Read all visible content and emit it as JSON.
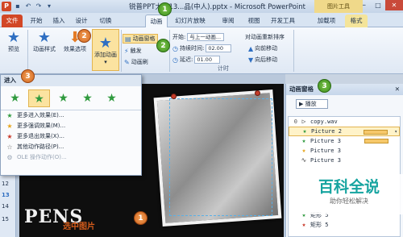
{
  "window": {
    "app_logo": "P",
    "title": "锐普PPT大赛13...品(中人).pptx - Microsoft PowerPoint",
    "controls": [
      "─",
      "□",
      "✕"
    ],
    "qat_icons": [
      "save-icon",
      "undo-icon",
      "redo-icon",
      "customize-icon"
    ]
  },
  "ribbon_tabs": {
    "file": "文件",
    "tabs": [
      "开始",
      "插入",
      "设计",
      "切换",
      "动画",
      "幻灯片放映",
      "审阅",
      "视图",
      "开发工具",
      "加载项",
      "格式"
    ],
    "active": "动画",
    "context_header": "图片工具"
  },
  "ribbon": {
    "preview": "预览",
    "animation_style": "动画样式",
    "effect_options": "效果选项",
    "add_animation": "添加动画",
    "animation_pane": "动画窗格",
    "trigger": "触发",
    "animation_painter": "动画刷",
    "start_label": "开始:",
    "start_value": "与上一动画...",
    "duration_label": "持续时间:",
    "duration_value": "02.00",
    "delay_label": "延迟:",
    "delay_value": "01.00",
    "reorder_title": "对动画重新排序",
    "move_earlier": "向前移动",
    "move_later": "向后移动",
    "group_timing": "计时"
  },
  "dropdown": {
    "header": "进入",
    "items": [
      {
        "icon": "star-icon",
        "label": "更多进入效果(E)...",
        "disabled": false
      },
      {
        "icon": "star-icon",
        "label": "更多强调效果(M)...",
        "disabled": false
      },
      {
        "icon": "star-icon",
        "label": "更多退出效果(X)...",
        "disabled": false
      },
      {
        "icon": "star-icon",
        "label": "其他动作路径(P)...",
        "disabled": false
      },
      {
        "icon": "gear-icon",
        "label": "OLE 操作动作(O)...",
        "disabled": true
      }
    ]
  },
  "slides": {
    "numbers": [
      "12",
      "13",
      "14",
      "15"
    ],
    "selected": "13"
  },
  "slide": {
    "big_text": "PENS",
    "select_label": "选中图片"
  },
  "badges": [
    "1",
    "2",
    "2",
    "3",
    "3"
  ],
  "anim_pane": {
    "title": "动画窗格",
    "close": "✕",
    "play": "▶ 播放",
    "rows": [
      {
        "num": "0",
        "icon": "play-icon",
        "label": "copy.wav",
        "selected": false,
        "bar": false
      },
      {
        "num": "",
        "icon": "star-icon",
        "label": "Picture 2",
        "selected": true,
        "bar": true
      },
      {
        "num": "",
        "icon": "star-icon",
        "label": "Picture 3",
        "selected": false,
        "bar": true
      },
      {
        "num": "",
        "icon": "star-icon",
        "label": "Picture 3",
        "selected": false,
        "bar": false
      },
      {
        "num": "",
        "icon": "path-icon",
        "label": "Picture 3",
        "selected": false,
        "bar": false
      },
      {
        "num": "",
        "icon": "star-icon",
        "label": "矩形 5",
        "selected": false,
        "bar": false
      },
      {
        "num": "",
        "icon": "star-icon",
        "label": "矩形 5",
        "selected": false,
        "bar": false
      }
    ]
  },
  "watermark": {
    "main": "百科全说",
    "sub": "助你轻松解决"
  }
}
